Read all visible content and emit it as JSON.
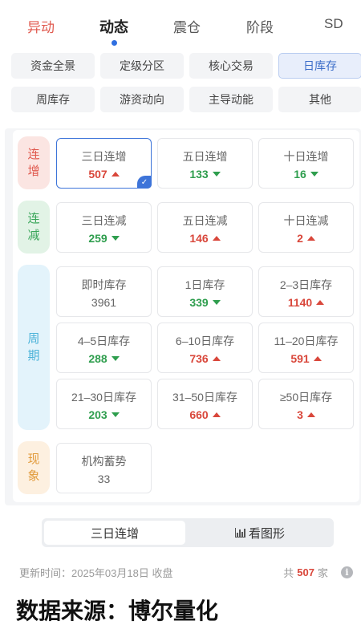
{
  "top_tabs": [
    {
      "label": "异动",
      "state": "red"
    },
    {
      "label": "动态",
      "state": "active"
    },
    {
      "label": "震仓",
      "state": "normal"
    },
    {
      "label": "阶段",
      "state": "normal"
    },
    {
      "label": "SD",
      "state": "normal"
    }
  ],
  "filters": [
    {
      "label": "资金全景"
    },
    {
      "label": "定级分区"
    },
    {
      "label": "核心交易"
    },
    {
      "label": "日库存",
      "active": true
    },
    {
      "label": "周库存"
    },
    {
      "label": "游资动向"
    },
    {
      "label": "主导动能"
    },
    {
      "label": "其他"
    }
  ],
  "groups": {
    "rise": {
      "label": "连增"
    },
    "fall": {
      "label": "连减"
    },
    "period": {
      "label": "周期"
    },
    "phenomenon": {
      "label": "现象"
    }
  },
  "cards": {
    "rise_3": {
      "title": "三日连增",
      "value": "507",
      "trend": "up"
    },
    "rise_5": {
      "title": "五日连增",
      "value": "133",
      "trend": "down"
    },
    "rise_10": {
      "title": "十日连增",
      "value": "16",
      "trend": "down"
    },
    "fall_3": {
      "title": "三日连减",
      "value": "259",
      "trend": "down"
    },
    "fall_5": {
      "title": "五日连减",
      "value": "146",
      "trend": "up"
    },
    "fall_10": {
      "title": "十日连减",
      "value": "2",
      "trend": "up"
    },
    "p_now": {
      "title": "即时库存",
      "value": "3961",
      "trend": "none"
    },
    "p_1": {
      "title": "1日库存",
      "value": "339",
      "trend": "down"
    },
    "p_2_3": {
      "title": "2–3日库存",
      "value": "1140",
      "trend": "up"
    },
    "p_4_5": {
      "title": "4–5日库存",
      "value": "288",
      "trend": "down"
    },
    "p_6_10": {
      "title": "6–10日库存",
      "value": "736",
      "trend": "up"
    },
    "p_11_20": {
      "title": "11–20日库存",
      "value": "591",
      "trend": "up"
    },
    "p_21_30": {
      "title": "21–30日库存",
      "value": "203",
      "trend": "down"
    },
    "p_31_50": {
      "title": "31–50日库存",
      "value": "660",
      "trend": "up"
    },
    "p_50": {
      "title": "≥50日库存",
      "value": "3",
      "trend": "up"
    },
    "inst": {
      "title": "机构蓄势",
      "value": "33",
      "trend": "none"
    }
  },
  "segment": {
    "selected": "三日连增",
    "chart_label": "看图形"
  },
  "meta": {
    "update_label": "更新时间：",
    "update_time": "2025年03月18日 收盘",
    "count_prefix": "共",
    "count": "507",
    "count_suffix": "家",
    "info_glyph": "i"
  },
  "source": "数据来源：博尔量化",
  "colors": {
    "up": "#d9473b",
    "down": "#2f9e4e",
    "accent": "#3d74d9"
  }
}
